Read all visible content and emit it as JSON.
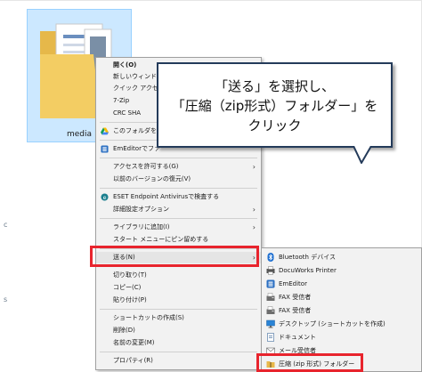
{
  "folder": {
    "name": "media"
  },
  "stray_texts": [
    "c",
    "s"
  ],
  "context_menu": {
    "items": [
      {
        "label": "開く(O)",
        "bold": true,
        "icon": "none",
        "submenu": false
      },
      {
        "label": "新しいウィンドウ",
        "bold": false,
        "icon": "none",
        "submenu": false
      },
      {
        "label": "クイック アクセス",
        "bold": false,
        "icon": "none",
        "submenu": false
      },
      {
        "label": "7-Zip",
        "bold": false,
        "icon": "none",
        "submenu": false
      },
      {
        "label": "CRC SHA",
        "bold": false,
        "icon": "none",
        "submenu": false
      },
      {
        "label": "このフォルダを同",
        "bold": false,
        "icon": "google-drive-icon",
        "submenu": false
      },
      {
        "label": "EmEditorでファ",
        "bold": false,
        "icon": "emeditor-icon",
        "submenu": false
      },
      {
        "label": "アクセスを許可する(G)",
        "bold": false,
        "icon": "none",
        "submenu": true
      },
      {
        "label": "以前のバージョンの復元(V)",
        "bold": false,
        "icon": "none",
        "submenu": false
      },
      {
        "label": "ESET Endpoint Antivirusで検査する",
        "bold": false,
        "icon": "eset-icon",
        "submenu": false
      },
      {
        "label": "詳細設定オプション",
        "bold": false,
        "icon": "none",
        "submenu": true
      },
      {
        "label": "ライブラリに追加(I)",
        "bold": false,
        "icon": "none",
        "submenu": true
      },
      {
        "label": "スタート メニューにピン留めする",
        "bold": false,
        "icon": "none",
        "submenu": false
      },
      {
        "label": "送る(N)",
        "bold": false,
        "icon": "none",
        "submenu": true
      },
      {
        "label": "切り取り(T)",
        "bold": false,
        "icon": "none",
        "submenu": false
      },
      {
        "label": "コピー(C)",
        "bold": false,
        "icon": "none",
        "submenu": false
      },
      {
        "label": "貼り付け(P)",
        "bold": false,
        "icon": "none",
        "submenu": false
      },
      {
        "label": "ショートカットの作成(S)",
        "bold": false,
        "icon": "none",
        "submenu": false
      },
      {
        "label": "削除(D)",
        "bold": false,
        "icon": "none",
        "submenu": false
      },
      {
        "label": "名前の変更(M)",
        "bold": false,
        "icon": "none",
        "submenu": false
      },
      {
        "label": "プロパティ(R)",
        "bold": false,
        "icon": "none",
        "submenu": false
      }
    ]
  },
  "send_to_menu": {
    "items": [
      {
        "label": "Bluetooth デバイス",
        "icon": "bluetooth-icon"
      },
      {
        "label": "DocuWorks Printer",
        "icon": "printer-icon"
      },
      {
        "label": "EmEditor",
        "icon": "emeditor-icon"
      },
      {
        "label": "FAX 受信者",
        "icon": "fax-icon"
      },
      {
        "label": "FAX 受信者",
        "icon": "fax-icon"
      },
      {
        "label": "デスクトップ (ショートカットを作成)",
        "icon": "desktop-icon"
      },
      {
        "label": "ドキュメント",
        "icon": "documents-icon"
      },
      {
        "label": "メール受信者",
        "icon": "mail-icon"
      },
      {
        "label": "圧縮 (zip 形式) フォルダー",
        "icon": "zip-folder-icon"
      }
    ]
  },
  "callout": {
    "lines": [
      "「送る」を選択し、",
      "「圧縮（zip形式）フォルダー」を",
      "クリック"
    ]
  },
  "colors": {
    "highlight": "#e8242d",
    "selection": "#cce8ff",
    "callout_border": "#243b5a",
    "menu_bg": "#f2f2f2"
  }
}
